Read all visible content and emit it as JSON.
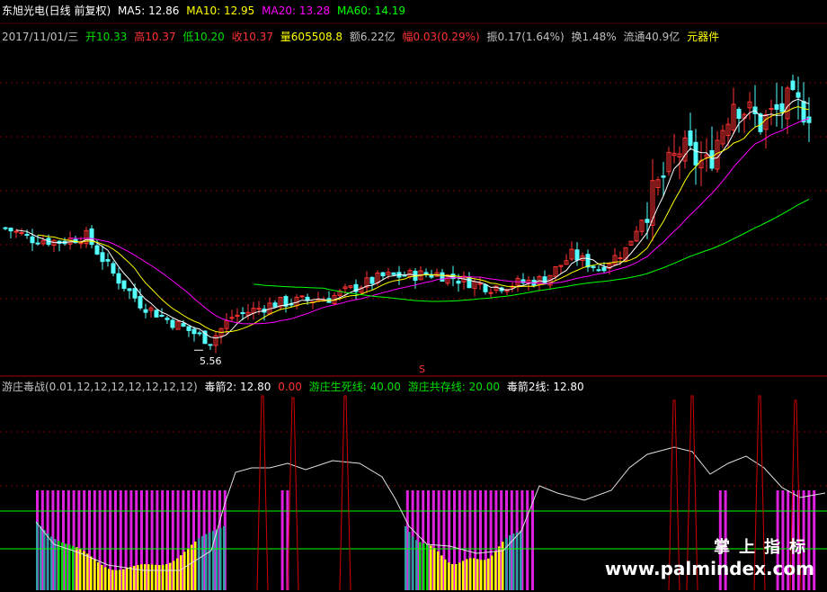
{
  "header": {
    "title": "东旭光电(日线 前复权)",
    "ma5": "MA5: 12.86",
    "ma10": "MA10: 12.95",
    "ma20": "MA20: 13.28",
    "ma60": "MA60: 14.19",
    "date": "2017/11/01/三",
    "open": "开10.33",
    "high": "高10.37",
    "low": "低10.20",
    "close": "收10.37",
    "volume": "量605508.8",
    "amount": "额6.22亿",
    "change": "幅0.03(0.29%)",
    "amplitude": "振0.17(1.64%)",
    "turnover": "换1.48%",
    "float_cap": "流通40.9亿",
    "sector": "元器件"
  },
  "sub_header": {
    "name": "游庄毒战(0.01,12,12,12,12,12,12,12)",
    "arrow": "毒箭2: 12.80",
    "arrow_val": "0.00",
    "life_death": "游庄生死线: 40.00",
    "coexist": "游庄共存线: 20.00",
    "arrow2": "毒箭2线: 12.80"
  },
  "watermark": {
    "cn": "掌上指标",
    "url": "www.palmindex.com"
  },
  "colors": {
    "up": "#ff3232",
    "down": "#54ffff",
    "ma5": "#ffffff",
    "ma10": "#ffff00",
    "ma20": "#ff00ff",
    "ma60": "#00ff00",
    "magenta_bar": "#e020e0",
    "yellow_bar": "#ffff00",
    "teal_bar": "#2aa0a0",
    "green_bar": "#00e000"
  },
  "chart_data": [
    {
      "type": "candlestick",
      "series": [
        "MA5",
        "MA10",
        "MA20",
        "MA60"
      ],
      "annotations": [
        "5.56"
      ],
      "low_marker": {
        "value": 5.56
      },
      "last_bar": {
        "date": "2017/11/01",
        "open": 10.33,
        "high": 10.37,
        "low": 10.2,
        "close": 10.37
      },
      "ma_values": {
        "MA5": 12.86,
        "MA10": 12.95,
        "MA20": 13.28,
        "MA60": 14.19
      },
      "grid": true
    },
    {
      "type": "indicator",
      "lines": {
        "life_death_line": 40.0,
        "coexist_line": 20.0
      },
      "values": {
        "arrow2": 12.8,
        "arrow": 0.0
      },
      "legend": [
        "毒箭2",
        "游庄生死线",
        "游庄共存线",
        "毒箭2线"
      ]
    }
  ]
}
